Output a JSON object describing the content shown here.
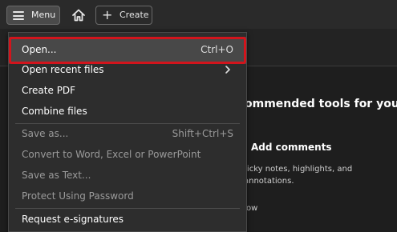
{
  "toolbar": {
    "menu_label": "Menu",
    "create_label": "Create",
    "icons": [
      "hamburger-icon",
      "home-icon",
      "plus-icon"
    ]
  },
  "recommended": {
    "title": "ommended tools for you",
    "tool_heading": "Add comments",
    "tool_desc_line1": "ticky notes, highlights, and",
    "tool_desc_line2": "annotations.",
    "tool_link": "ow"
  },
  "menu": {
    "items": [
      {
        "label": "Open...",
        "shortcut": "Ctrl+O",
        "enabled": true,
        "highlighted": true
      },
      {
        "label": "Open recent files",
        "submenu": true,
        "enabled": true
      },
      {
        "label": "Create PDF",
        "enabled": true
      },
      {
        "label": "Combine files",
        "enabled": true
      },
      {
        "label": "Save as...",
        "shortcut": "Shift+Ctrl+S",
        "enabled": false
      },
      {
        "label": "Convert to Word, Excel or PowerPoint",
        "enabled": false
      },
      {
        "label": "Save as Text...",
        "enabled": false
      },
      {
        "label": "Protect Using Password",
        "enabled": false
      },
      {
        "label": "Request e-signatures",
        "enabled": true
      }
    ]
  },
  "colors": {
    "highlight_border": "#d2141c",
    "menu_bg": "#2d2d2d",
    "app_bg": "#1e1e1e"
  }
}
